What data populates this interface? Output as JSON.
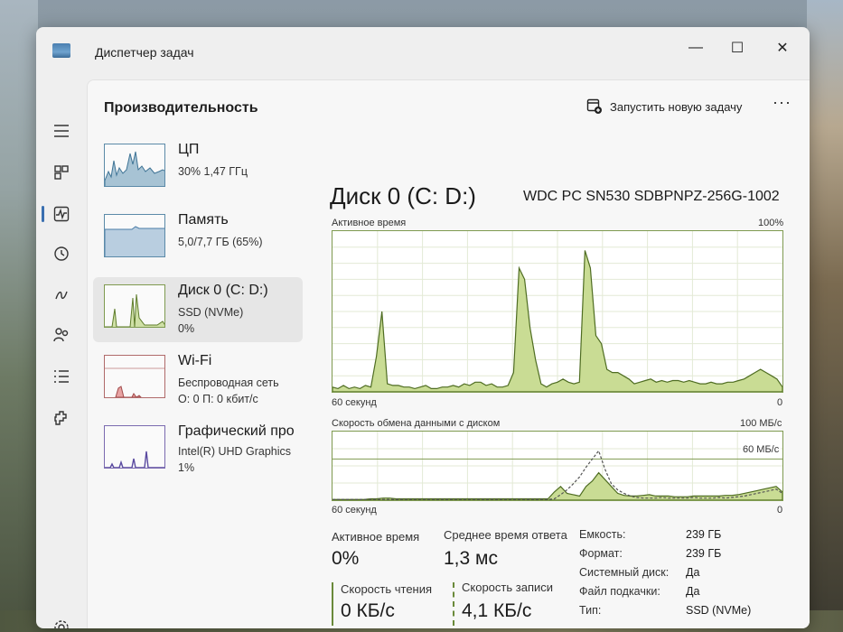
{
  "app": {
    "title": "Диспетчер задач"
  },
  "window_controls": {
    "minimize": "—",
    "maximize": "☐",
    "close": "✕"
  },
  "header": {
    "title": "Производительность",
    "run_new_task": "Запустить новую задачу",
    "more": "···"
  },
  "nav": {
    "icons": [
      "hamburger-icon",
      "processes-icon",
      "performance-icon",
      "history-icon",
      "startup-icon",
      "users-icon",
      "details-icon",
      "services-icon",
      "settings-icon"
    ]
  },
  "perf_items": [
    {
      "name": "ЦП",
      "line1": "30% 1,47 ГГц",
      "line2": ""
    },
    {
      "name": "Память",
      "line1": "5,0/7,7 ГБ (65%)",
      "line2": ""
    },
    {
      "name": "Диск 0 (C: D:)",
      "line1": "SSD (NVMe)",
      "line2": "0%"
    },
    {
      "name": "Wi-Fi",
      "line1": "Беспроводная сеть",
      "line2": "О: 0 П: 0 кбит/с"
    },
    {
      "name": "Графический про",
      "line1": "Intel(R) UHD Graphics",
      "line2": "1%"
    }
  ],
  "disk": {
    "title": "Диск 0 (C: D:)",
    "model": "WDC PC SN530 SDBPNPZ-256G-1002"
  },
  "active_graph": {
    "label": "Активное время",
    "max_label": "100%",
    "x_left": "60 секунд",
    "x_right": "0",
    "values": [
      3,
      2,
      4,
      2,
      3,
      2,
      4,
      3,
      22,
      50,
      5,
      4,
      4,
      3,
      3,
      2,
      3,
      4,
      2,
      2,
      3,
      3,
      4,
      3,
      5,
      4,
      6,
      6,
      4,
      5,
      3,
      3,
      4,
      12,
      77,
      70,
      40,
      20,
      5,
      3,
      5,
      6,
      8,
      6,
      5,
      6,
      88,
      77,
      35,
      30,
      14,
      12,
      12,
      10,
      8,
      5,
      6,
      7,
      8,
      6,
      7,
      6,
      7,
      7,
      6,
      7,
      6,
      5,
      5,
      6,
      5,
      5,
      6,
      6,
      7,
      8,
      10,
      12,
      14,
      12,
      10,
      8,
      3
    ],
    "color": "#7fa03c"
  },
  "transfer_graph": {
    "label": "Скорость обмена данными с диском",
    "max_label": "100 МБ/с",
    "line_label": "60 МБ/с",
    "x_left": "60 секунд",
    "x_right": "0",
    "write_values": [
      1,
      1,
      1,
      1,
      1,
      1,
      2,
      2,
      3,
      3,
      2,
      2,
      2,
      2,
      2,
      2,
      2,
      2,
      2,
      2,
      2,
      2,
      2,
      2,
      2,
      2,
      2,
      2,
      2,
      2,
      2,
      2,
      2,
      2,
      2,
      12,
      20,
      10,
      8,
      6,
      20,
      28,
      40,
      30,
      20,
      10,
      7,
      6,
      6,
      7,
      8,
      6,
      6,
      6,
      5,
      5,
      5,
      6,
      6,
      6,
      6,
      6,
      7,
      7,
      8,
      10,
      12,
      14,
      16,
      18,
      20,
      12
    ],
    "read_values": [
      1,
      1,
      1,
      1,
      1,
      1,
      1,
      1,
      1,
      1,
      1,
      1,
      1,
      1,
      1,
      1,
      1,
      1,
      1,
      1,
      1,
      1,
      1,
      1,
      1,
      1,
      1,
      1,
      1,
      1,
      1,
      1,
      1,
      1,
      1,
      2,
      8,
      15,
      24,
      34,
      48,
      60,
      72,
      45,
      24,
      15,
      10,
      6,
      4,
      3,
      3,
      3,
      4,
      3,
      3,
      3,
      3,
      4,
      3,
      3,
      3,
      4,
      3,
      4,
      5,
      6,
      8,
      10,
      12,
      14,
      16,
      10
    ],
    "color": "#7fa03c"
  },
  "stats": {
    "active_time_label": "Активное время",
    "active_time_value": "0%",
    "avg_response_label": "Среднее время ответа",
    "avg_response_value": "1,3 мс",
    "read_speed_label": "Скорость чтения",
    "read_speed_value": "0 КБ/с",
    "write_speed_label": "Скорость записи",
    "write_speed_value": "4,1 КБ/с"
  },
  "info": [
    {
      "key": "Емкость:",
      "value": "239 ГБ"
    },
    {
      "key": "Формат:",
      "value": "239 ГБ"
    },
    {
      "key": "Системный диск:",
      "value": "Да"
    },
    {
      "key": "Файл подкачки:",
      "value": "Да"
    },
    {
      "key": "Тип:",
      "value": "SSD (NVMe)"
    }
  ]
}
